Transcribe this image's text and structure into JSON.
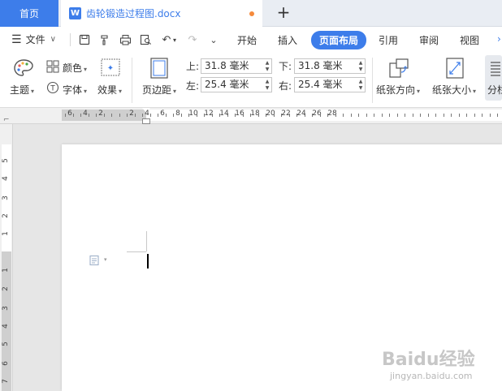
{
  "tabbar": {
    "home_label": "首页",
    "doc_icon_letter": "W",
    "doc_title": "齿轮锻造过程图.docx",
    "new_tab_symbol": "+"
  },
  "menubar": {
    "file_label": "文件",
    "tabs": [
      {
        "label": "开始"
      },
      {
        "label": "插入"
      },
      {
        "label": "页面布局"
      },
      {
        "label": "引用"
      },
      {
        "label": "审阅"
      },
      {
        "label": "视图"
      }
    ],
    "active_tab": "页面布局"
  },
  "ribbon": {
    "theme_label": "主题",
    "color_label": "颜色",
    "font_label": "字体",
    "effect_label": "效果",
    "margins_label": "页边距",
    "top_label": "上:",
    "bottom_label": "下:",
    "left_label": "左:",
    "right_label": "右:",
    "top_value": "31.8 毫米",
    "bottom_value": "31.8 毫米",
    "left_value": "25.4 毫米",
    "right_value": "25.4 毫米",
    "orientation_label": "纸张方向",
    "size_label": "纸张大小",
    "columns_label": "分栏"
  },
  "hruler": {
    "numbers": [
      "6",
      "4",
      "2",
      "2",
      "4",
      "6",
      "8",
      "10",
      "12",
      "14",
      "16",
      "18",
      "20",
      "22",
      "24",
      "26",
      "28"
    ]
  },
  "vruler": {
    "numbers": [
      "5",
      "4",
      "3",
      "2",
      "1",
      "1",
      "2",
      "3",
      "4",
      "5",
      "6",
      "7"
    ]
  },
  "watermark": {
    "brand": "Baidu经验",
    "site": "jingyan.baidu.com"
  },
  "colors": {
    "accent": "#3d7dea",
    "modified_dot": "#f58a3b"
  }
}
